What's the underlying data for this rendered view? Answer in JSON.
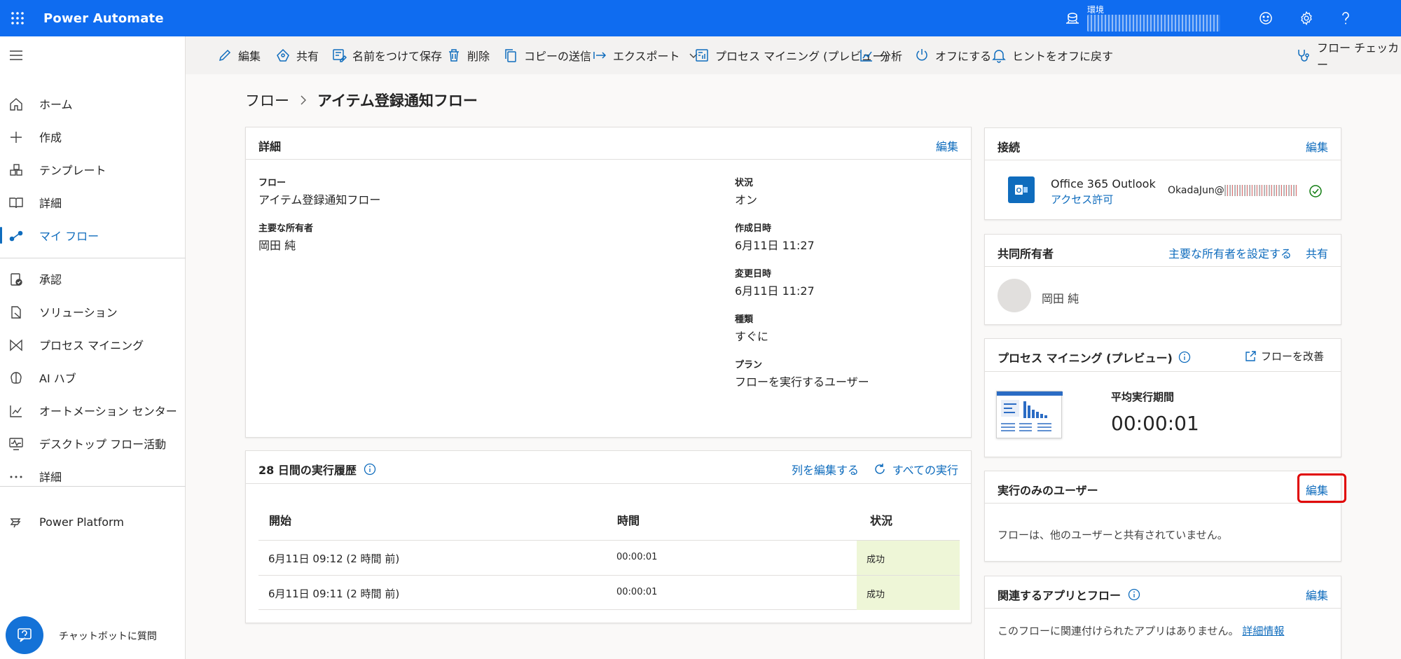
{
  "header": {
    "app_title": "Power Automate",
    "env_label": "環境",
    "icons": [
      "waffle-icon",
      "environment-icon",
      "smiley-icon",
      "gear-icon",
      "help-icon"
    ],
    "brand_color": "#0f6cf0"
  },
  "sidebar": {
    "items": [
      {
        "label": "ホーム",
        "icon": "home-icon"
      },
      {
        "label": "作成",
        "icon": "plus-icon"
      },
      {
        "label": "テンプレート",
        "icon": "template-icon"
      },
      {
        "label": "詳細",
        "icon": "book-icon"
      },
      {
        "label": "マイ フロー",
        "icon": "flow-icon",
        "active": true
      },
      {
        "label": "承認",
        "icon": "approval-icon"
      },
      {
        "label": "ソリューション",
        "icon": "solution-icon"
      },
      {
        "label": "プロセス マイニング",
        "icon": "process-mining-icon"
      },
      {
        "label": "AI ハブ",
        "icon": "ai-hub-icon"
      },
      {
        "label": "オートメーション センター",
        "icon": "chart-icon"
      },
      {
        "label": "デスクトップ フロー活動",
        "icon": "desktop-activity-icon"
      },
      {
        "label": "詳細",
        "icon": "more-icon"
      },
      {
        "label": "Power Platform",
        "icon": "power-platform-icon"
      }
    ],
    "chatbot_label": "チャットボットに質問"
  },
  "commands": {
    "edit": "編集",
    "share": "共有",
    "save_as": "名前をつけて保存",
    "delete": "削除",
    "send_copy": "コピーの送信",
    "export": "エクスポート",
    "process_mining": "プロセス マイニング (プレビュー)",
    "analytics": "分析",
    "turn_off": "オフにする",
    "tips_off": "ヒントをオフに戻す",
    "flow_checker": "フロー チェッカー"
  },
  "breadcrumb": {
    "root": "フロー",
    "current": "アイテム登録通知フロー"
  },
  "details": {
    "title": "詳細",
    "edit": "編集",
    "flow_label": "フロー",
    "flow_value": "アイテム登録通知フロー",
    "owner_label": "主要な所有者",
    "owner_value": "岡田 純",
    "status_label": "状況",
    "status_value": "オン",
    "created_label": "作成日時",
    "created_value": "6月11日 11:27",
    "modified_label": "変更日時",
    "modified_value": "6月11日 11:27",
    "type_label": "種類",
    "type_value": "すぐに",
    "plan_label": "プラン",
    "plan_value": "フローを実行するユーザー"
  },
  "runs": {
    "title": "28 日間の実行履歴",
    "edit_columns": "列を編集する",
    "all_runs": "すべての実行",
    "columns": [
      "開始",
      "時間",
      "状況"
    ],
    "rows": [
      {
        "start": "6月11日 09:12 (2 時間 前)",
        "duration": "00:00:01",
        "status": "成功"
      },
      {
        "start": "6月11日 09:11 (2 時間 前)",
        "duration": "00:00:01",
        "status": "成功"
      }
    ]
  },
  "connections": {
    "title": "接続",
    "edit": "編集",
    "service": "Office 365 Outlook",
    "access": "アクセス許可",
    "account": "OkadaJun@"
  },
  "coowners": {
    "title": "共同所有者",
    "set_owner": "主要な所有者を設定する",
    "share": "共有",
    "owner": "岡田 純"
  },
  "process_mining": {
    "title": "プロセス マイニング (プレビュー)",
    "improve": "フローを改善",
    "avg_label": "平均実行期間",
    "avg_value": "00:00:01"
  },
  "run_only": {
    "title": "実行のみのユーザー",
    "edit": "編集",
    "message": "フローは、他のユーザーと共有されていません。"
  },
  "related": {
    "title": "関連するアプリとフロー",
    "edit": "編集",
    "message": "このフローに関連付けられたアプリはありません。",
    "link": "詳細情報"
  }
}
